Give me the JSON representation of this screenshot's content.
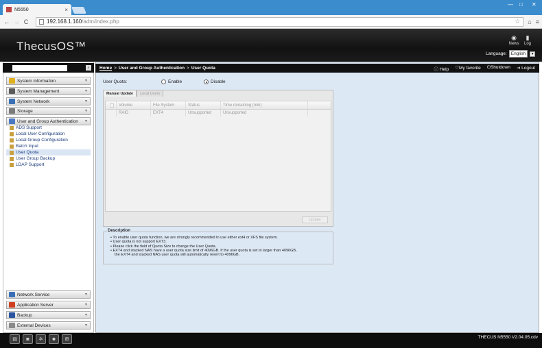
{
  "browser": {
    "tab_title": "N5550",
    "tab_close": "×",
    "address_host": "192.168.1.160",
    "address_path": "/adm/index.php",
    "back_icon": "←",
    "forward_icon": "→",
    "reload_icon": "C",
    "home_icon": "⌂",
    "bookmark_icon": "☆",
    "menu_icon": "≡"
  },
  "window_controls": {
    "minimize": "—",
    "maximize": "□",
    "close": "✕"
  },
  "header": {
    "brand": "ThecusOS™",
    "news_label": "News",
    "log_label": "Log",
    "language_label": "Language:",
    "language_value": "English"
  },
  "sidebar": {
    "menu_top": [
      {
        "label": "System Information",
        "color": "#e0b020"
      },
      {
        "label": "System Management",
        "color": "#5a5a5a"
      },
      {
        "label": "System Network",
        "color": "#3a6fb5"
      },
      {
        "label": "Storage",
        "color": "#7a7a7a"
      },
      {
        "label": "User and Group Authentication",
        "color": "#4a78c2"
      }
    ],
    "submenu": [
      {
        "label": "ADS Support",
        "active": false
      },
      {
        "label": "Local User Configuration",
        "active": false
      },
      {
        "label": "Local Group Configuration",
        "active": false
      },
      {
        "label": "Batch Input",
        "active": false
      },
      {
        "label": "User Quota",
        "active": true
      },
      {
        "label": "User Group Backup",
        "active": false
      },
      {
        "label": "LDAP Support",
        "active": false
      }
    ],
    "menu_bottom": [
      {
        "label": "Network Service",
        "color": "#3a6fb5"
      },
      {
        "label": "Application Server",
        "color": "#d04020"
      },
      {
        "label": "Backup",
        "color": "#2b55a0"
      },
      {
        "label": "External Devices",
        "color": "#8a8a8a"
      }
    ]
  },
  "breadcrumb": {
    "home": "Home",
    "sep": ">",
    "section": "User and Group Authentication",
    "page": "User Quota"
  },
  "top_actions": {
    "help": "Help",
    "favorite": "My favorite",
    "shutdown": "Shutdown",
    "logout": "Logout"
  },
  "quota": {
    "label": "User Quota:",
    "enable": "Enable",
    "disable": "Disable",
    "selected": "disable"
  },
  "tabs": [
    "Manual Update",
    "Local Users"
  ],
  "grid": {
    "columns": [
      "Volume",
      "File System",
      "Status",
      "Time remaining (min)"
    ],
    "rows": [
      [
        "RAID",
        "EXT4",
        "Unsupported",
        "Unsupported"
      ]
    ]
  },
  "apply_label": "Update",
  "description": {
    "title": "Description",
    "items": [
      "To enable user quota function, we are strongly recommended to use either ext4 or XFS file system.",
      "User quota is not support EXT3.",
      "Please click the field of Quota Size to change the User Quota.",
      "EXT4 and stacked NAS have a user quota size limit of 4096GB. If the user quota is set to larger than 4096GB,"
    ],
    "item_continuation": "the EXT4 and stacked NAS user quota will automatically revert to 4096GB."
  },
  "footer": {
    "version": "THECUS N5550 V2.04.05.cdv"
  }
}
